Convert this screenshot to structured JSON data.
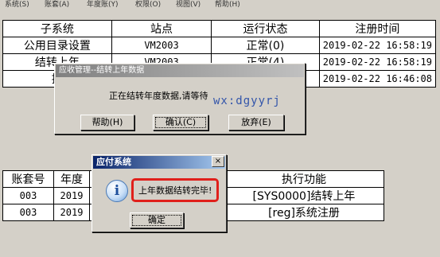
{
  "menu": [
    "系统(S)",
    "账套(A)",
    "年度账(Y)",
    "权限(O)",
    "视图(V)",
    "帮助(H)"
  ],
  "top_table": {
    "headers": [
      "子系统",
      "站点",
      "运行状态",
      "注册时间"
    ],
    "rows": [
      [
        "公用目录设置",
        "VM2003",
        "正常(0)",
        "2019-02-22 16:58:19"
      ],
      [
        "结转上年",
        "VM2003",
        "正常(4)",
        "2019-02-22 16:58:19"
      ],
      [
        "控",
        "",
        "",
        "2019-02-22 16:46:08"
      ]
    ]
  },
  "bottom_table": {
    "headers": [
      "账套号",
      "年度",
      "",
      "执行功能"
    ],
    "rows": [
      [
        "003",
        "2019",
        "",
        "[SYS0000]结转上年"
      ],
      [
        "003",
        "2019",
        "",
        "[reg]系统注册"
      ]
    ]
  },
  "dialog1": {
    "title": "应收管理--结转上年数据",
    "message": "正在结转年度数据,请等待",
    "buttons": [
      "帮助(H)",
      "确认(C)",
      "放弃(E)"
    ]
  },
  "watermark": "wx:dgyyrj",
  "dialog2": {
    "title": "应付系统",
    "message": "上年数据结转完毕!",
    "ok": "确定",
    "close": "×",
    "icon_glyph": "i"
  }
}
